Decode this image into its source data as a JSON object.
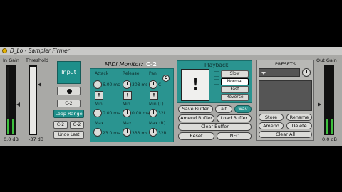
{
  "device": {
    "title": "D_Lo - Sampler Firmer"
  },
  "input_gain": {
    "label": "In Gain",
    "value": "0.0 dB",
    "level": 0.22
  },
  "threshold": {
    "label": "Threshold",
    "value": "-37 dB",
    "level": 0.0
  },
  "input_panel": {
    "input_button": "Input",
    "note": "C-2",
    "loop_range": "Loop Range",
    "c2": "C-2",
    "g2": "G-2",
    "undo_last": "Undo Last"
  },
  "midi_monitor": {
    "label": "MIDI Monitor:",
    "note": "C-2",
    "c_badge": "C",
    "attack": {
      "label": "Attack",
      "value": "6.00 ms"
    },
    "release": {
      "label": "Release",
      "value": "308 ms"
    },
    "pan": {
      "label": "Pan",
      "value": "C"
    },
    "attack_min": {
      "label": "Min",
      "value": "0.00 ms"
    },
    "release_min": {
      "label": "Min",
      "value": "0.00 ms"
    },
    "pan_min": {
      "label": "Min (L)",
      "value": "32L"
    },
    "attack_max": {
      "label": "Max",
      "value": "23.0 ms"
    },
    "release_max": {
      "label": "Max",
      "value": "333 ms"
    },
    "pan_max": {
      "label": "Max (R)",
      "value": "32R"
    },
    "rand": "!"
  },
  "playback": {
    "label": "Playback",
    "big_button": "!",
    "options": [
      "Slow",
      "Normal",
      "Fast",
      "Reverse"
    ],
    "selected": "Normal",
    "save_buffer": "Save Buffer",
    "aif": "aif",
    "wav": "wav",
    "amend_buffer": "Amend Buffer",
    "load_buffer": "Load Buffer",
    "clear_buffer": "Clear Buffer",
    "reset": "Reset",
    "info": "INFO"
  },
  "presets": {
    "label": "PRESETS",
    "store": "Store",
    "rename": "Rename",
    "amend": "Amend",
    "delete": "Delete",
    "clear_all": "Clear All"
  },
  "output_gain": {
    "label": "Out Gain",
    "value": "0.0 dB",
    "level": 0.22
  },
  "colors": {
    "teal": "#2a9490",
    "meter_green": "#3dbf3d",
    "toggle_yellow": "#e8b400"
  }
}
